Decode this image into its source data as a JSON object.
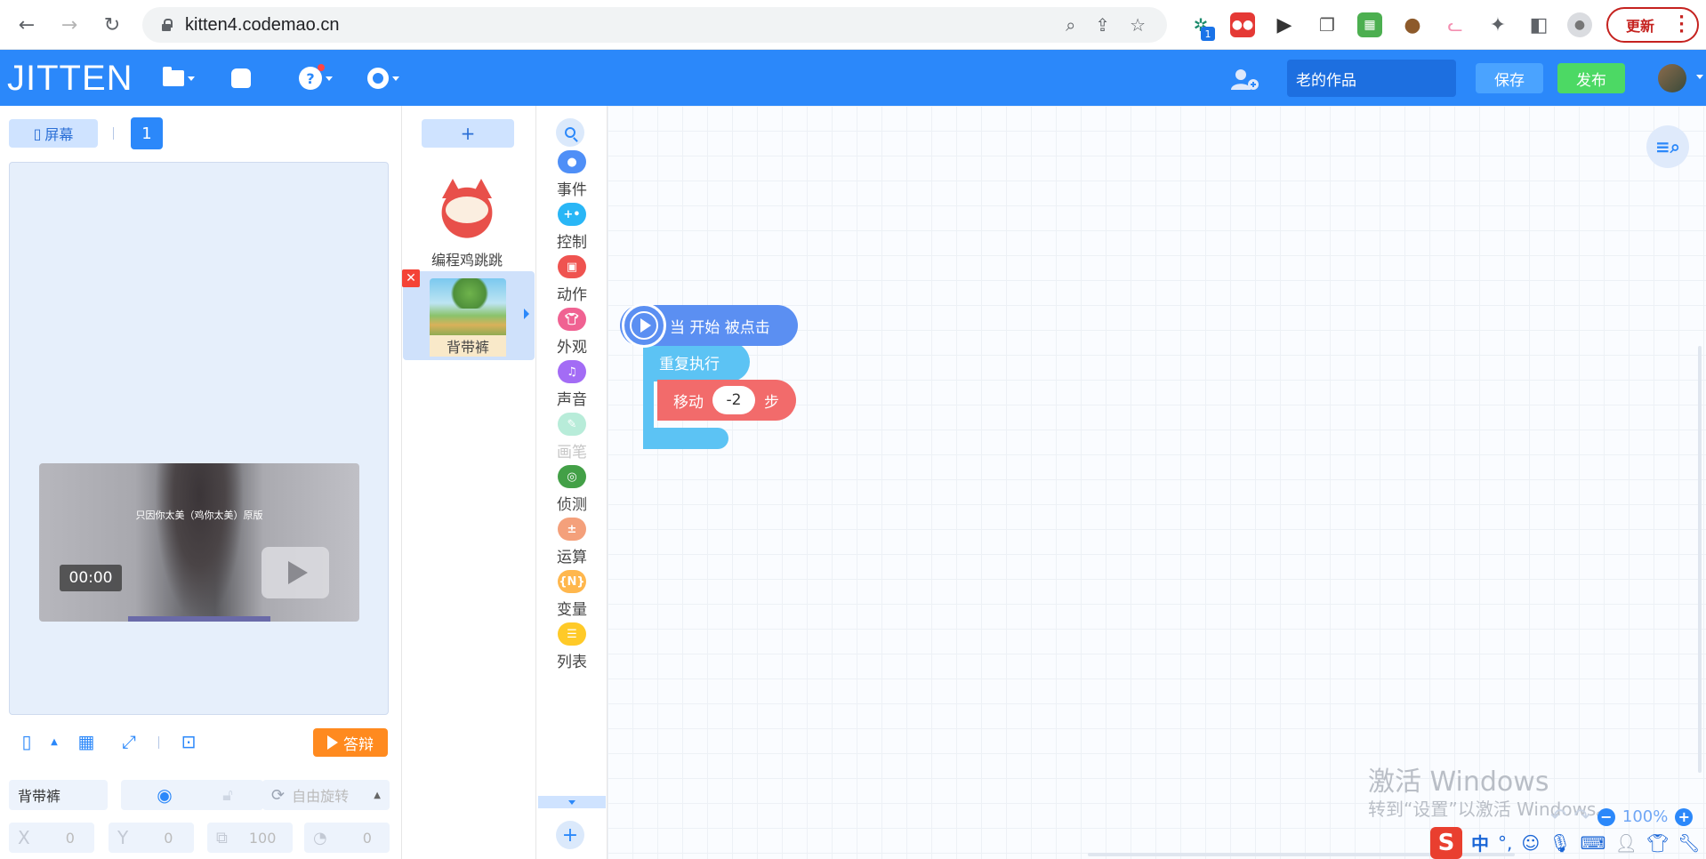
{
  "browser": {
    "url": "kitten4.codemao.cn",
    "extension_badge": "1",
    "update_label": "更新"
  },
  "app": {
    "logo": "JITTEN",
    "project_name": "老的作品",
    "save_label": "保存",
    "publish_label": "发布"
  },
  "stage": {
    "screen_label": "屏幕",
    "screen_number": "1",
    "video_title": "只因你太美（鸡你太美）原版",
    "video_time": "00:00",
    "answer_label": "答辩"
  },
  "properties": {
    "sprite_name": "背带裤",
    "rotation_label": "自由旋转",
    "x_label": "X",
    "x_value": "0",
    "y_label": "Y",
    "y_value": "0",
    "size_value": "100",
    "direction_value": "0"
  },
  "sprites": {
    "add_label": "+",
    "items": [
      {
        "name": "编程鸡跳跳"
      },
      {
        "name": "背带裤"
      }
    ],
    "delete_label": "✕"
  },
  "categories": [
    {
      "label": "事件",
      "color": "#4f8ff7"
    },
    {
      "label": "控制",
      "color": "#29b6f6"
    },
    {
      "label": "动作",
      "color": "#ef5350"
    },
    {
      "label": "外观",
      "color": "#f06292"
    },
    {
      "label": "声音",
      "color": "#a36cf5"
    },
    {
      "label": "画笔",
      "color": "#b8ecd9"
    },
    {
      "label": "侦测",
      "color": "#43a047"
    },
    {
      "label": "运算",
      "color": "#f4a07b"
    },
    {
      "label": "变量",
      "color": "#ffb74d"
    },
    {
      "label": "列表",
      "color": "#ffca28"
    }
  ],
  "blocks": {
    "hat_label": "当 开始 被点击",
    "repeat_label": "重复执行",
    "move_label": "移动",
    "move_value": "-2",
    "move_unit": "步"
  },
  "workspace": {
    "watermark_title": "激活 Windows",
    "watermark_sub": "转到“设置”以激活 Windows。",
    "zoom": "100%",
    "ime_label": "中"
  }
}
